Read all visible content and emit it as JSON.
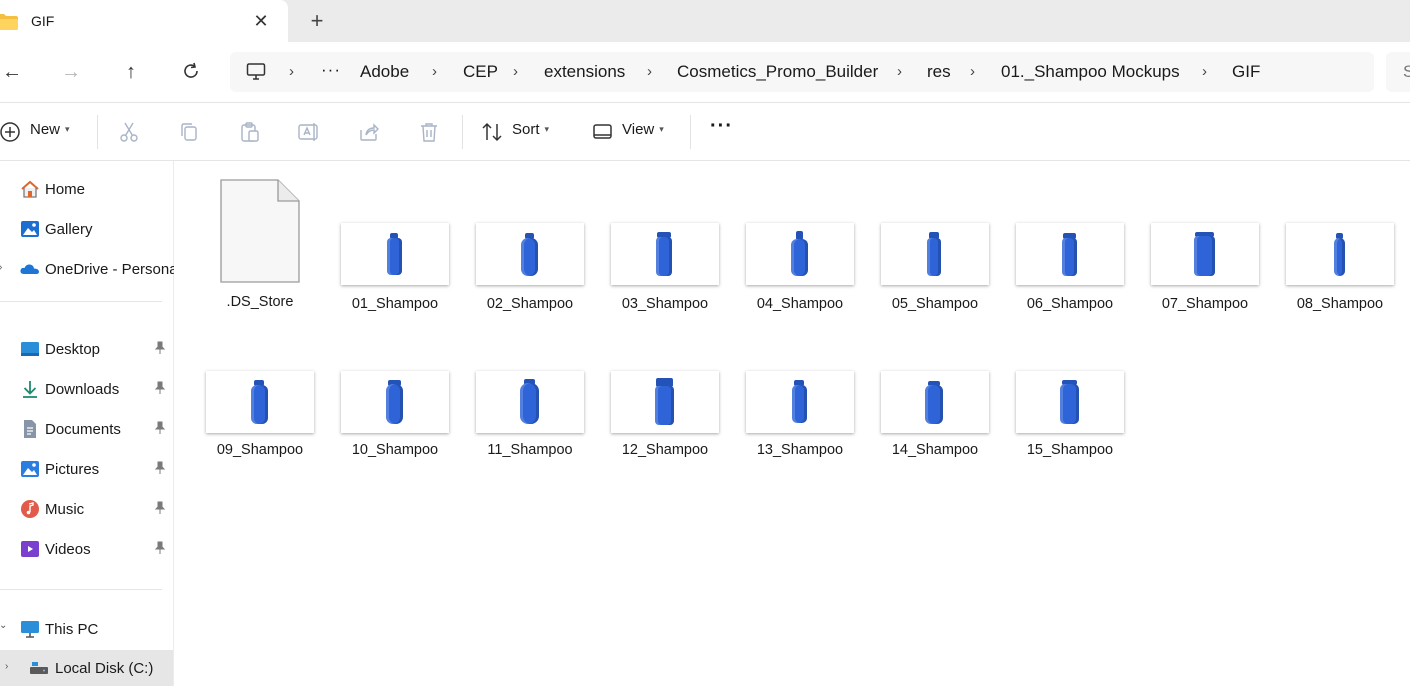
{
  "tab": {
    "title": "GIF",
    "close": "✕",
    "new": "+"
  },
  "address": {
    "crumbs": [
      "Adobe",
      "CEP",
      "extensions",
      "Cosmetics_Promo_Builder",
      "res",
      "01._Shampoo Mockups",
      "GIF"
    ],
    "overflow": "···",
    "search_partial": "S"
  },
  "toolbar": {
    "new_label": "New",
    "sort_label": "Sort",
    "view_label": "View",
    "more": "···"
  },
  "sidebar": {
    "quick": [
      {
        "label": "Home",
        "icon": "home-icon"
      },
      {
        "label": "Gallery",
        "icon": "gallery-icon"
      },
      {
        "label": "OneDrive - Persona",
        "icon": "onedrive-icon"
      }
    ],
    "pinned": [
      {
        "label": "Desktop",
        "icon": "desktop-icon"
      },
      {
        "label": "Downloads",
        "icon": "downloads-icon"
      },
      {
        "label": "Documents",
        "icon": "documents-icon"
      },
      {
        "label": "Pictures",
        "icon": "pictures-icon"
      },
      {
        "label": "Music",
        "icon": "music-icon"
      },
      {
        "label": "Videos",
        "icon": "videos-icon"
      }
    ],
    "devices": [
      {
        "label": "This PC",
        "icon": "this-pc-icon"
      },
      {
        "label": "Local Disk (C:)",
        "icon": "local-disk-icon"
      }
    ]
  },
  "files": [
    {
      "name": ".DS_Store",
      "type": "document"
    },
    {
      "name": "01_Shampoo",
      "type": "image"
    },
    {
      "name": "02_Shampoo",
      "type": "image"
    },
    {
      "name": "03_Shampoo",
      "type": "image"
    },
    {
      "name": "04_Shampoo",
      "type": "image"
    },
    {
      "name": "05_Shampoo",
      "type": "image"
    },
    {
      "name": "06_Shampoo",
      "type": "image"
    },
    {
      "name": "07_Shampoo",
      "type": "image"
    },
    {
      "name": "08_Shampoo",
      "type": "image"
    },
    {
      "name": "09_Shampoo",
      "type": "image"
    },
    {
      "name": "10_Shampoo",
      "type": "image"
    },
    {
      "name": "11_Shampoo",
      "type": "image"
    },
    {
      "name": "12_Shampoo",
      "type": "image"
    },
    {
      "name": "13_Shampoo",
      "type": "image"
    },
    {
      "name": "14_Shampoo",
      "type": "image"
    },
    {
      "name": "15_Shampoo",
      "type": "image"
    }
  ],
  "colors": {
    "bottle": "#2e64d8",
    "accent": "#0067c0",
    "folder": "#f3c042"
  }
}
